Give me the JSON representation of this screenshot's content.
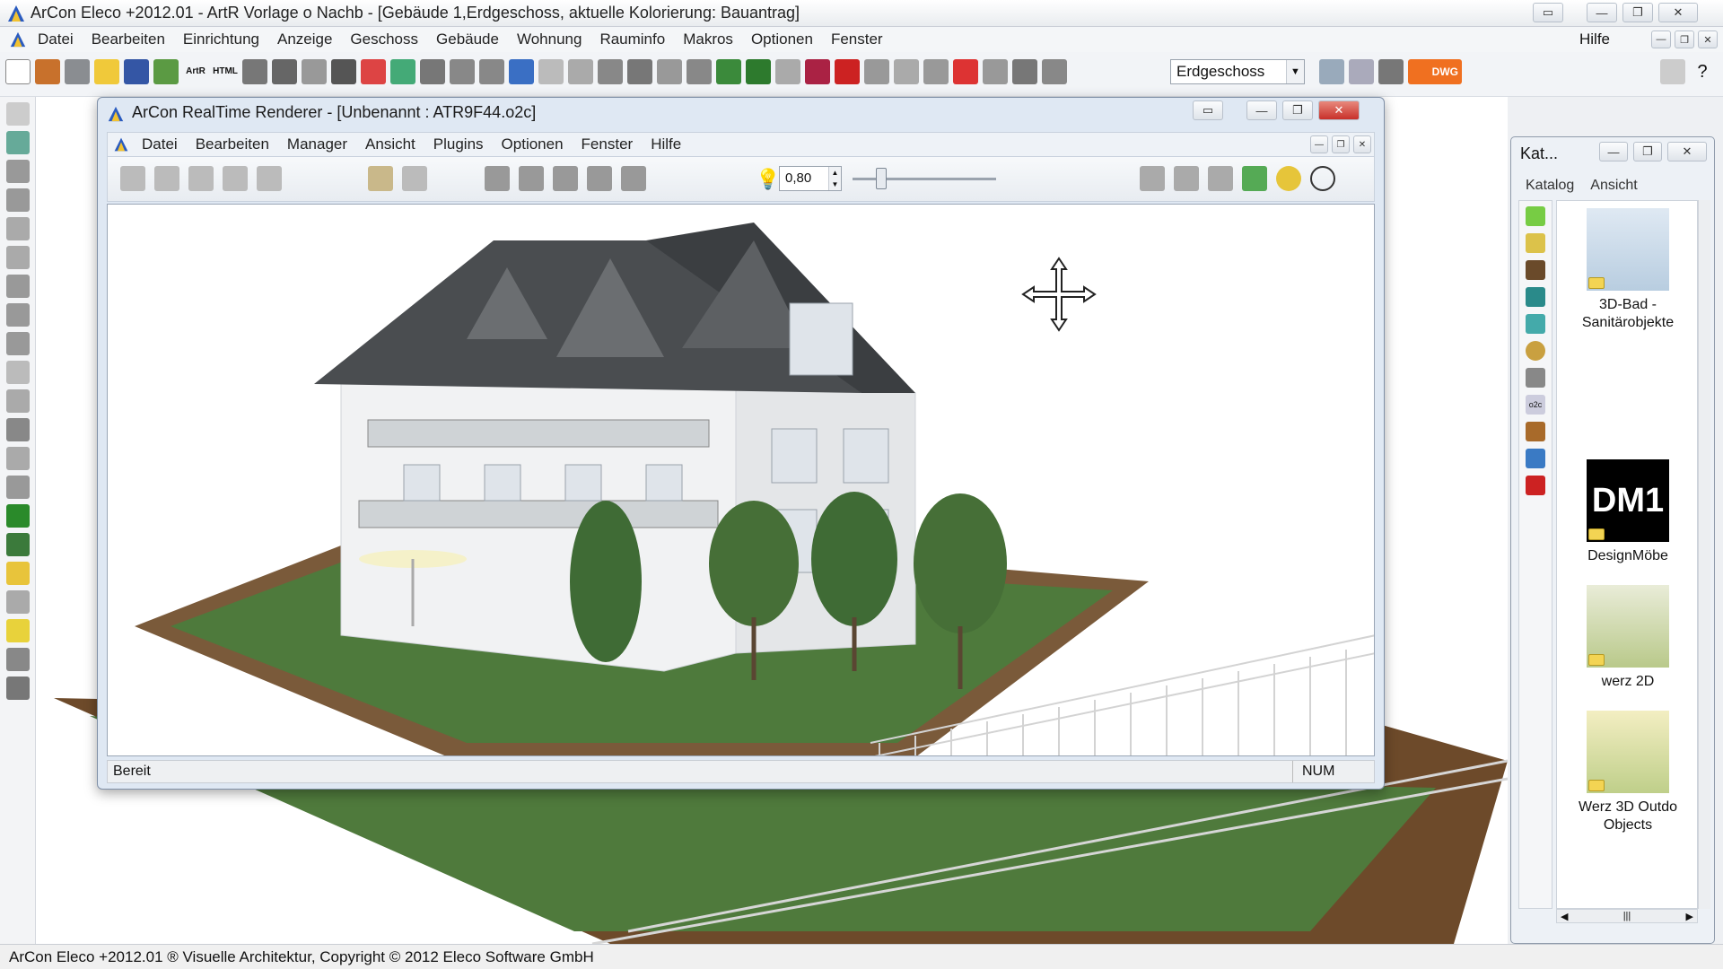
{
  "app": {
    "title": "ArCon Eleco  +2012.01 - ArtR Vorlage o Nachb - [Gebäude 1,Erdgeschoss, aktuelle Kolorierung: Bauantrag]",
    "menu": [
      "Datei",
      "Bearbeiten",
      "Einrichtung",
      "Anzeige",
      "Geschoss",
      "Gebäude",
      "Wohnung",
      "Rauminfo",
      "Makros",
      "Optionen",
      "Fenster"
    ],
    "help_menu": "Hilfe",
    "floor_combo": "Erdgeschoss",
    "status": "ArCon Eleco +2012.01 ® Visuelle Architektur, Copyright © 2012 Eleco Software GmbH",
    "toolbar_labels": {
      "artr": "ArtR",
      "html": "HTML",
      "dwg": "DWG"
    }
  },
  "renderer": {
    "title": "ArCon RealTime Renderer - [Unbenannt : ATR9F44.o2c]",
    "menu": [
      "Datei",
      "Bearbeiten",
      "Manager",
      "Ansicht",
      "Plugins",
      "Optionen",
      "Fenster",
      "Hilfe"
    ],
    "brightness_value": "0,80",
    "slider_level": 0.2,
    "status_left": "Bereit",
    "status_right": "NUM"
  },
  "catalog": {
    "title": "Kat...",
    "tabs": [
      "Katalog",
      "Ansicht"
    ],
    "items": [
      {
        "label": "3D-Bad - Sanitärobjekte",
        "icon": "bathroom-fixture-icon"
      },
      {
        "label": "DesignMöbe",
        "icon": "designmoebel-logo",
        "logo_text": "DM1"
      },
      {
        "label": "werz 2D",
        "icon": "werz-2d-thumbnail"
      },
      {
        "label": "Werz 3D Outdo Objects",
        "icon": "werz-3d-outdoor-thumbnail"
      }
    ]
  },
  "colors": {
    "accent_red": "#c8302a",
    "grass": "#4e7a3c",
    "roof": "#4a4d50",
    "wall": "#f4f5f6"
  }
}
